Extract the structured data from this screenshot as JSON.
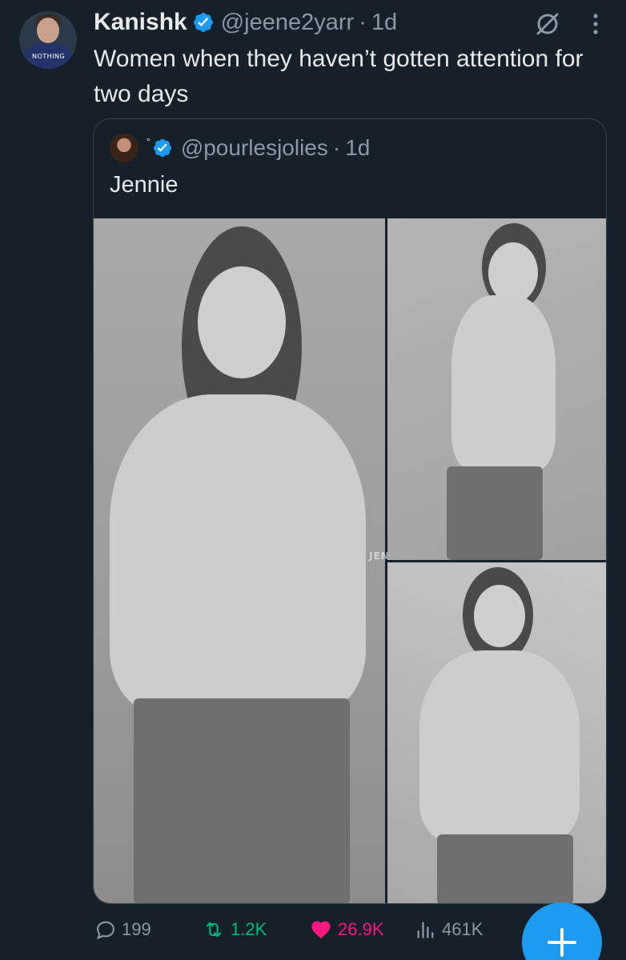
{
  "tweet": {
    "author": {
      "name": "Kanishk",
      "handle": "@jeene2yarr",
      "time": "1d",
      "avatar_text": "NOTHING"
    },
    "text": "Women when they haven’t gotten attention for two days",
    "icons": {
      "verified": "verified-badge-icon",
      "grok": "grok-icon",
      "more": "more-vertical-icon"
    }
  },
  "quoted": {
    "handle": "@pourlesjolies",
    "time": "1d",
    "name_mark": "°",
    "text": "Jennie",
    "watermark": "JENFI LESX",
    "photos": [
      "photo-main",
      "photo-top-right",
      "photo-bottom-right"
    ]
  },
  "actions": {
    "replies": "199",
    "retweets": "1.2K",
    "likes": "26.9K",
    "views": "461K"
  },
  "colors": {
    "background": "#15202b",
    "text": "#e7e9ea",
    "muted": "#8b98a5",
    "accent": "#1d9bf0",
    "retweet": "#00ba7c",
    "like": "#f91880",
    "border": "#38444d"
  }
}
